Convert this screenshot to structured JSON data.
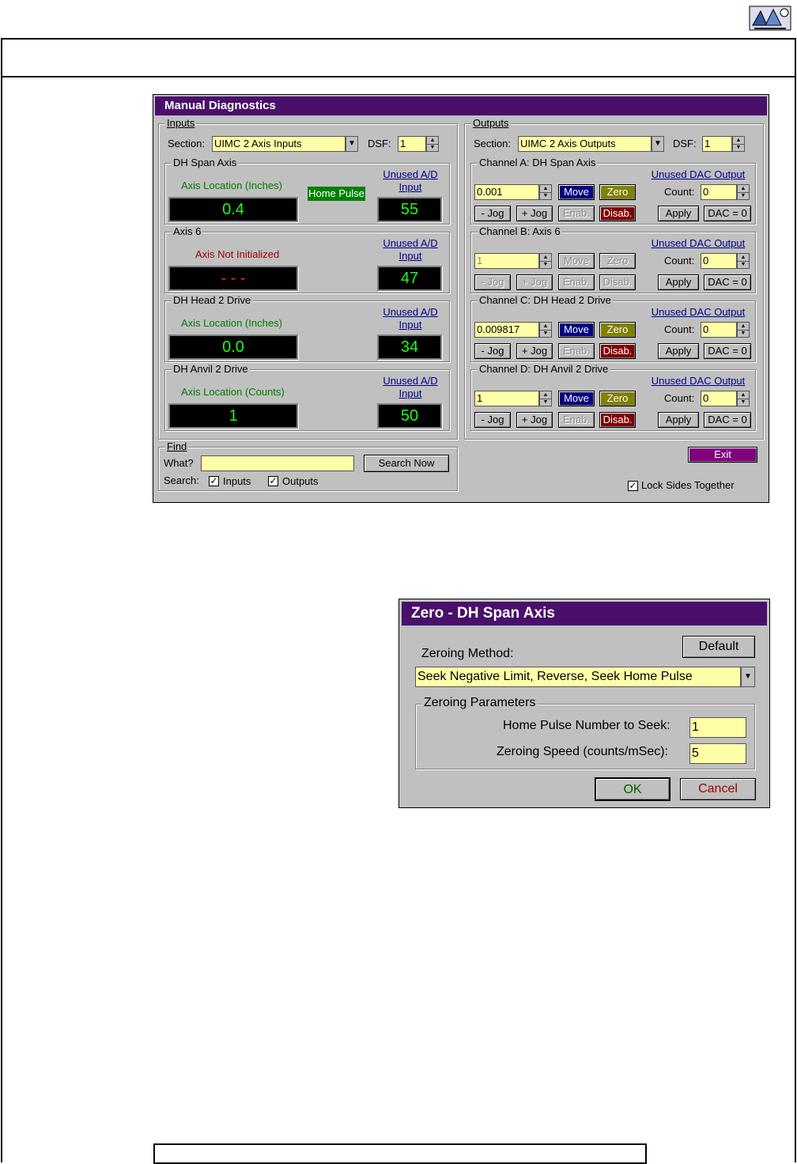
{
  "diagnostics": {
    "title": "Manual Diagnostics",
    "inputs": {
      "group_label": "Inputs",
      "section_label": "Section:",
      "section_value": "UIMC 2 Axis Inputs",
      "dsf_label": "DSF:",
      "dsf_value": "1",
      "axes": [
        {
          "name": "DH Span Axis",
          "status": "Axis Location (Inches)",
          "value": "0.4",
          "aux_label": "Unused A/D",
          "aux_label2": "Input",
          "aux_value": "55",
          "badge": "Home Pulse"
        },
        {
          "name": "Axis 6",
          "status": "Axis Not Initialized",
          "value": "- - -",
          "aux_label": "Unused A/D",
          "aux_label2": "Input",
          "aux_value": "47"
        },
        {
          "name": "DH Head 2 Drive",
          "status": "Axis Location (Inches)",
          "value": "0.0",
          "aux_label": "Unused A/D",
          "aux_label2": "Input",
          "aux_value": "34"
        },
        {
          "name": "DH Anvil 2 Drive",
          "status": "Axis Location (Counts)",
          "value": "1",
          "aux_label": "Unused A/D",
          "aux_label2": "Input",
          "aux_value": "50"
        }
      ]
    },
    "outputs": {
      "group_label": "Outputs",
      "section_label": "Section:",
      "section_value": "UIMC 2 Axis Outputs",
      "dsf_label": "DSF:",
      "dsf_value": "1",
      "channels": [
        {
          "name": "Channel A: DH Span Axis",
          "value": "0.001",
          "dac_label": "Unused DAC Output",
          "count": "0"
        },
        {
          "name": "Channel B: Axis 6",
          "value": "1",
          "dac_label": "Unused DAC Output",
          "count": "0"
        },
        {
          "name": "Channel C: DH Head 2 Drive",
          "value": "0.009817",
          "dac_label": "Unused DAC Output",
          "count": "0"
        },
        {
          "name": "Channel D: DH Anvil 2 Drive",
          "value": "1",
          "dac_label": "Unused DAC Output",
          "count": "0"
        }
      ],
      "move_label": "Move",
      "zero_label": "Zero",
      "jog_minus": "- Jog",
      "jog_plus": "+ Jog",
      "enab_label": "Enab.",
      "disab_label": "Disab.",
      "count_label": "Count:",
      "apply_label": "Apply",
      "dac_zero_label": "DAC = 0"
    },
    "find": {
      "group_label": "Find",
      "what_label": "What?",
      "what_value": "",
      "search_button": "Search Now",
      "search_label": "Search:",
      "inputs_check": "Inputs",
      "outputs_check": "Outputs"
    },
    "exit_label": "Exit",
    "lock_label": "Lock Sides Together"
  },
  "zero_dialog": {
    "title": "Zero  -  DH Span Axis",
    "method_label": "Zeroing Method:",
    "default_button": "Default",
    "method_value": "Seek Negative Limit, Reverse, Seek Home Pulse",
    "params_label": "Zeroing Parameters",
    "home_pulse_label": "Home Pulse Number to Seek:",
    "home_pulse_value": "1",
    "speed_label": "Zeroing Speed (counts/mSec):",
    "speed_value": "5",
    "ok_button": "OK",
    "cancel_button": "Cancel"
  }
}
